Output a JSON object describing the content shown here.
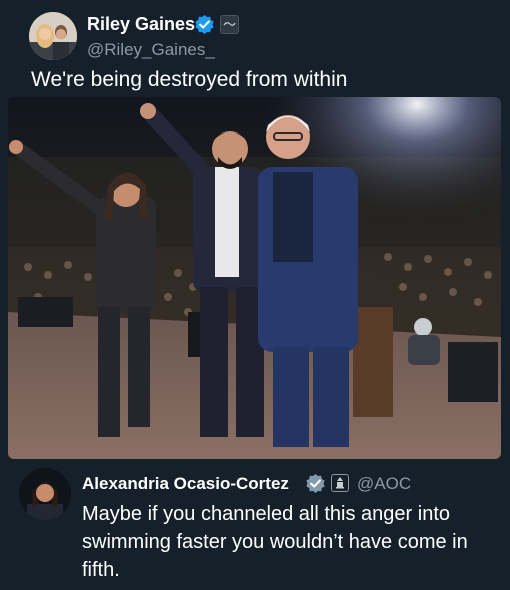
{
  "post": {
    "author_name": "Riley Gaines",
    "author_handle": "@Riley_Gaines_",
    "text": "We're being destroyed from within",
    "verified_color": "#1d9bf0",
    "avatar_icon": "avatar-photo",
    "media_icon": "stage-photo"
  },
  "reply": {
    "author_name": "Alexandria Ocasio-Cortez",
    "author_handle": "@AOC",
    "text": "Maybe if you channeled all this anger into swimming faster you wouldn’t have come in fifth.",
    "verified_color": "#829aab",
    "avatar_icon": "avatar-photo",
    "badge_icon": "capitol-icon"
  },
  "theme": {
    "background": "#15202b",
    "text_primary": "#ffffff",
    "text_secondary": "#8b98a5"
  }
}
